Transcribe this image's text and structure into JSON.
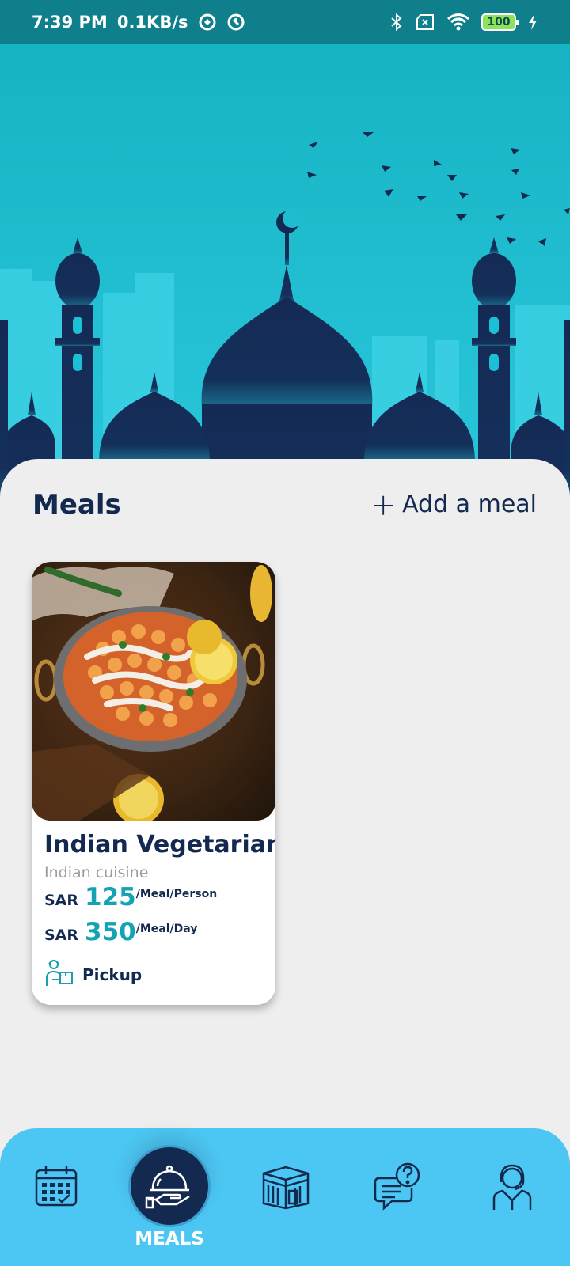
{
  "status_bar": {
    "time": "7:39 PM",
    "speed": "0.1KB/s",
    "battery": "100",
    "icons": [
      "data-saver-icon",
      "data-saver-icon",
      "bluetooth-icon",
      "sim-off-icon",
      "wifi-icon",
      "battery-icon",
      "charging-icon"
    ]
  },
  "hero": {
    "image": "mosque-skyline-illustration"
  },
  "meals_section": {
    "title": "Meals",
    "add_plus": "+",
    "add_label": "Add a meal"
  },
  "meal_card": {
    "image": "indian-curry-dish-photo",
    "name": "Indian Vegetarian",
    "cuisine": "Indian cuisine",
    "price_per_person": {
      "currency": "SAR",
      "amount": "125",
      "unit": "/Meal/Person"
    },
    "price_per_day": {
      "currency": "SAR",
      "amount": "350",
      "unit": "/Meal/Day"
    },
    "delivery": {
      "icon": "pickup-delivery-icon",
      "label": "Pickup"
    }
  },
  "bottom_nav": {
    "items": [
      {
        "icon": "calendar-icon",
        "label": ""
      },
      {
        "icon": "meals-cloche-icon",
        "label": "MEALS",
        "active": true
      },
      {
        "icon": "kaaba-icon",
        "label": ""
      },
      {
        "icon": "chat-question-icon",
        "label": ""
      },
      {
        "icon": "profile-agent-icon",
        "label": ""
      }
    ]
  },
  "colors": {
    "status_bar": "#0f7f8c",
    "hero_bg": "#22bfd2",
    "navy": "#14294f",
    "price_accent": "#13a3b3",
    "nav_bg": "#4cc7f3"
  }
}
